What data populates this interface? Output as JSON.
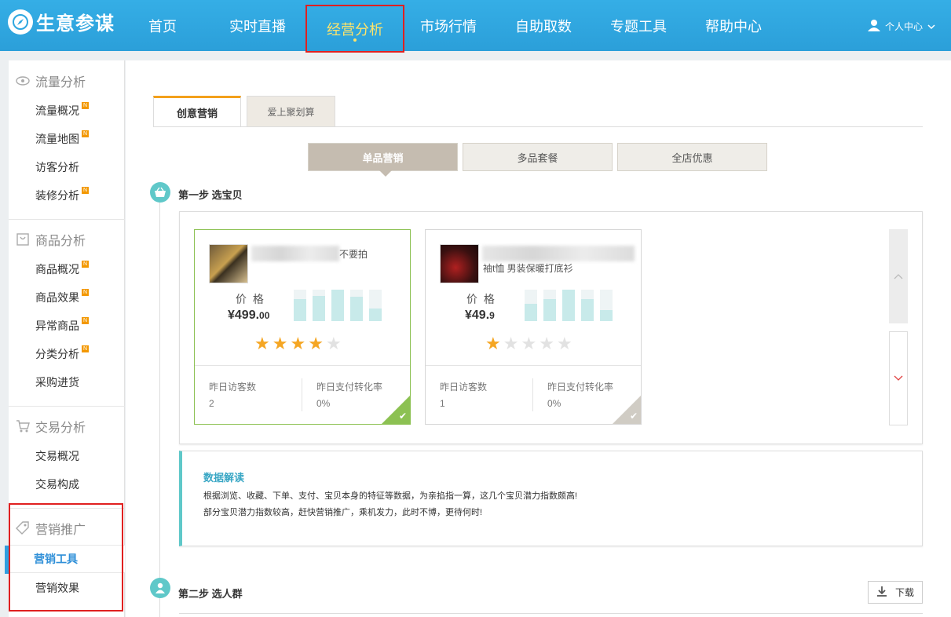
{
  "brand": {
    "name": "生意参谋"
  },
  "nav": {
    "items": [
      {
        "label": "首页"
      },
      {
        "label": "实时直播"
      },
      {
        "label": "经营分析"
      },
      {
        "label": "市场行情"
      },
      {
        "label": "自助取数"
      },
      {
        "label": "专题工具"
      },
      {
        "label": "帮助中心"
      }
    ],
    "active_index": 2,
    "user_label": "个人中心"
  },
  "sidebar": {
    "sections": [
      {
        "title": "流量分析",
        "icon": "eye-icon",
        "items": [
          {
            "label": "流量概况",
            "badge": "N"
          },
          {
            "label": "流量地图",
            "badge": "N"
          },
          {
            "label": "访客分析"
          },
          {
            "label": "装修分析",
            "badge": "N"
          }
        ]
      },
      {
        "title": "商品分析",
        "icon": "bag-icon",
        "items": [
          {
            "label": "商品概况",
            "badge": "N"
          },
          {
            "label": "商品效果",
            "badge": "N"
          },
          {
            "label": "异常商品",
            "badge": "N"
          },
          {
            "label": "分类分析",
            "badge": "N"
          },
          {
            "label": "采购进货"
          }
        ]
      },
      {
        "title": "交易分析",
        "icon": "cart-icon",
        "items": [
          {
            "label": "交易概况"
          },
          {
            "label": "交易构成"
          }
        ]
      },
      {
        "title": "营销推广",
        "icon": "tag-icon",
        "items": [
          {
            "label": "营销工具",
            "active": true
          },
          {
            "label": "营销效果"
          }
        ]
      }
    ]
  },
  "main": {
    "tabs": [
      {
        "label": "创意营销"
      },
      {
        "label": "爱上聚划算"
      }
    ],
    "segments": [
      {
        "label": "单品营销"
      },
      {
        "label": "多品套餐"
      },
      {
        "label": "全店优惠"
      }
    ],
    "step1_title": "第一步 选宝贝",
    "step2_title": "第二步 选人群",
    "download_label": "下载",
    "products": [
      {
        "name_tail": "不要拍",
        "price_label": "价 格",
        "price_main": "¥499.",
        "price_decimal": "00",
        "rating": 4,
        "visitors_label": "昨日访客数",
        "visitors": "2",
        "conversion_label": "昨日支付转化率",
        "conversion": "0%",
        "selected": true,
        "bar_levels": [
          0.7,
          0.8,
          1.0,
          0.78,
          0.4
        ]
      },
      {
        "name_tail": "袖t恤 男装保暖打底衫",
        "price_label": "价 格",
        "price_main": "¥49.",
        "price_decimal": "9",
        "rating": 1,
        "visitors_label": "昨日访客数",
        "visitors": "1",
        "conversion_label": "昨日支付转化率",
        "conversion": "0%",
        "selected": false,
        "bar_levels": [
          0.55,
          0.7,
          1.0,
          0.7,
          0.35
        ]
      }
    ],
    "insight": {
      "title": "数据解读",
      "lines": [
        "根据浏览、收藏、下单、支付、宝贝本身的特征等数据，为亲掐指一算，这几个宝贝潜力指数颇高!",
        "部分宝贝潜力指数较高，赶快营销推广，乘机发力，此时不博，更待何时!"
      ]
    }
  },
  "colors": {
    "header": "#2ea7e0",
    "active_nav": "#ffe46a",
    "accent_teal": "#5fc8c9",
    "star": "#f5a623",
    "selected": "#8cc152"
  }
}
